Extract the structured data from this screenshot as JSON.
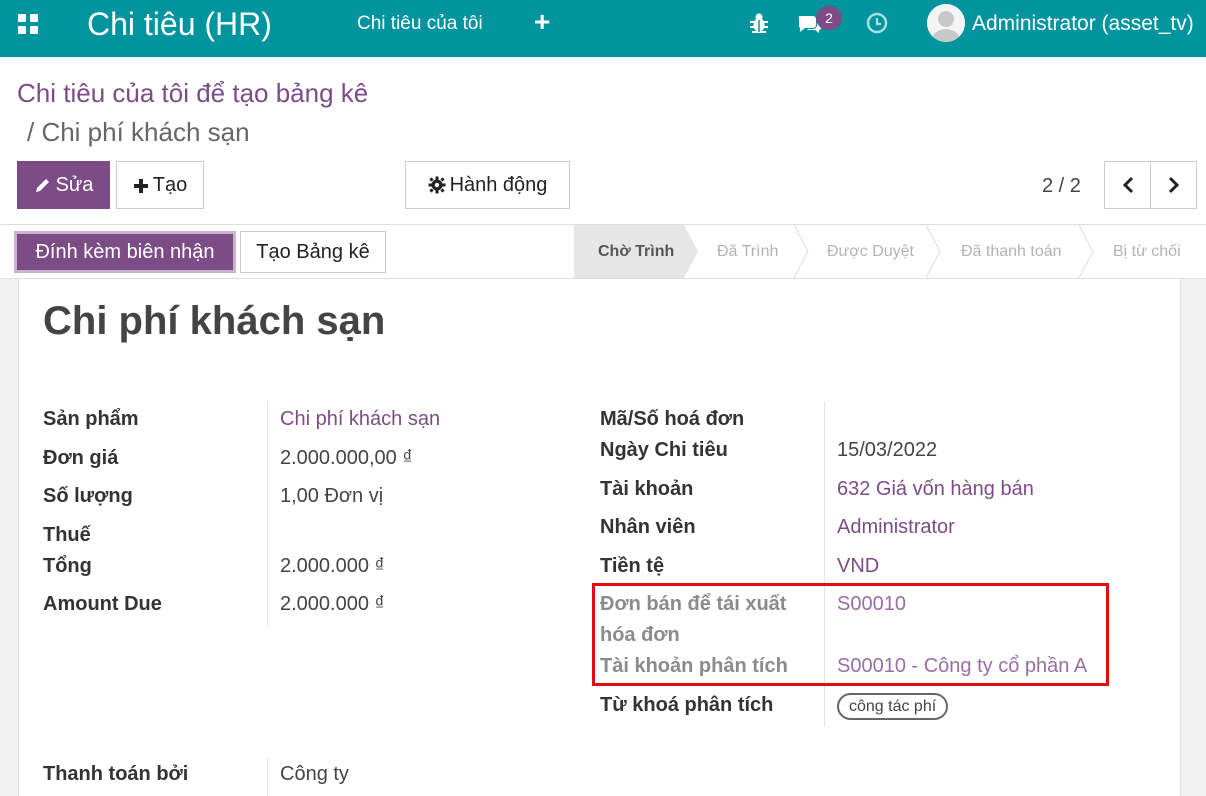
{
  "navbar": {
    "title": "Chi tiêu (HR)",
    "menu_my_expenses": "Chi tiêu của tôi",
    "plus": "+",
    "messages_count": "2",
    "user": "Administrator (asset_tv)",
    "bg_color": "#00959e"
  },
  "breadcrumb": {
    "parent": "Chi tiêu của tôi để tạo bảng kê",
    "current": "/ Chi phí khách sạn"
  },
  "toolbar": {
    "edit_label": "Sửa",
    "create_label": "Tạo",
    "action_label": "Hành động",
    "pager": "2 / 2"
  },
  "statusbar": {
    "attach_label": "Đính kèm biên nhận",
    "create_report_label": "Tạo Bảng kê",
    "stages": [
      "Chờ Trình",
      "Đã Trình",
      "Được Duyệt",
      "Đã thanh toán",
      "Bị từ chối"
    ],
    "active_stage": "Chờ Trình"
  },
  "form": {
    "title": "Chi phí khách sạn",
    "left": [
      {
        "label": "Sản phẩm",
        "value": "Chi phí khách sạn"
      },
      {
        "label": "Đơn giá",
        "value": "2.000.000,00 ₫"
      },
      {
        "label": "Số lượng",
        "value": "1,00  Đơn vị"
      },
      {
        "label": "Thuế",
        "value": ""
      },
      {
        "label": "Tổng",
        "value": "2.000.000 ₫"
      },
      {
        "label": "Amount Due",
        "value": "2.000.000 ₫"
      }
    ],
    "right": [
      {
        "label": "Mã/Số hoá đơn",
        "value": ""
      },
      {
        "label": "Ngày Chi tiêu",
        "value": "15/03/2022"
      },
      {
        "label": "Tài khoản",
        "value": "632 Giá vốn hàng bán"
      },
      {
        "label": "Nhân viên",
        "value": "Administrator"
      },
      {
        "label": "Tiền tệ",
        "value": "VND"
      },
      {
        "label_line1": "Đơn bán để tái xuất",
        "label_line2": "hóa đơn",
        "value": "S00010"
      },
      {
        "label": "Tài khoản phân tích",
        "value": "S00010 - Công ty cổ phần A"
      },
      {
        "label": "Từ khoá phân tích",
        "value": "công tác phí"
      }
    ],
    "payment": {
      "label": "Thanh toán bởi",
      "value": "Công ty"
    }
  },
  "colors": {
    "accent": "#7c4c86",
    "highlight": "#e01010"
  }
}
